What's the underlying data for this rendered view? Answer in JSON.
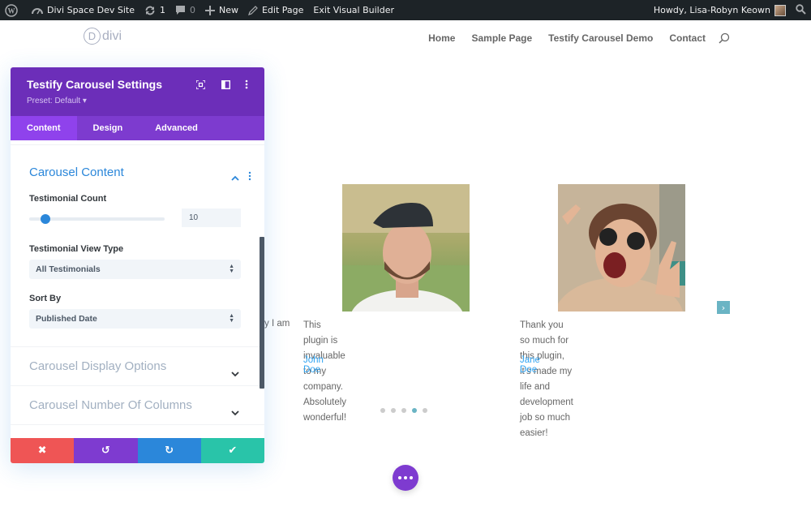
{
  "adminbar": {
    "wp_logo_icon": "wordpress-icon",
    "site_name": "Divi Space Dev Site",
    "updates_count": "1",
    "comments_count": "0",
    "new_label": "New",
    "edit_page_label": "Edit Page",
    "exit_builder_label": "Exit Visual Builder",
    "howdy_label": "Howdy, Lisa-Robyn Keown"
  },
  "site": {
    "logo_letter": "D",
    "logo_text": "divi",
    "nav": [
      "Home",
      "Sample Page",
      "Testify Carousel Demo",
      "Contact"
    ]
  },
  "carousel": {
    "partial_text": "y I am",
    "testimonials": [
      {
        "quote_line1": "This plugin is invaluable to my company.",
        "quote_line2": "Absolutely wonderful!",
        "name": "John Doe"
      },
      {
        "quote_line1": "Thank you so much for this plugin, it's made my",
        "quote_line2": "life and development job so much easier!",
        "name": "Jane Doe"
      }
    ],
    "next_arrow": "›",
    "dots_total": 5,
    "dots_active_index": 3,
    "accent_color": "#6ab4c4"
  },
  "panel": {
    "title": "Testify Carousel Settings",
    "preset": "Preset: Default ▾",
    "tabs": [
      "Content",
      "Design",
      "Advanced"
    ],
    "active_tab": "Content",
    "open_section": {
      "title": "Carousel Content",
      "testimonial_count_label": "Testimonial Count",
      "testimonial_count_value": "10",
      "slider_fraction": 0.12,
      "view_type_label": "Testimonial View Type",
      "view_type_value": "All Testimonials",
      "sort_by_label": "Sort By",
      "sort_by_value": "Published Date"
    },
    "closed_sections": [
      "Carousel Display Options",
      "Carousel Number Of Columns"
    ],
    "footer": {
      "cancel_icon": "✖",
      "undo_icon": "↺",
      "redo_icon": "↻",
      "save_icon": "✔"
    },
    "colors": {
      "header": "#6c2eb9",
      "tabs": "#7d3bcf",
      "active_tab": "#8f42ec",
      "cancel": "#ef5555",
      "undo": "#7e3bd0",
      "redo": "#2b87da",
      "save": "#29c4a9"
    }
  }
}
